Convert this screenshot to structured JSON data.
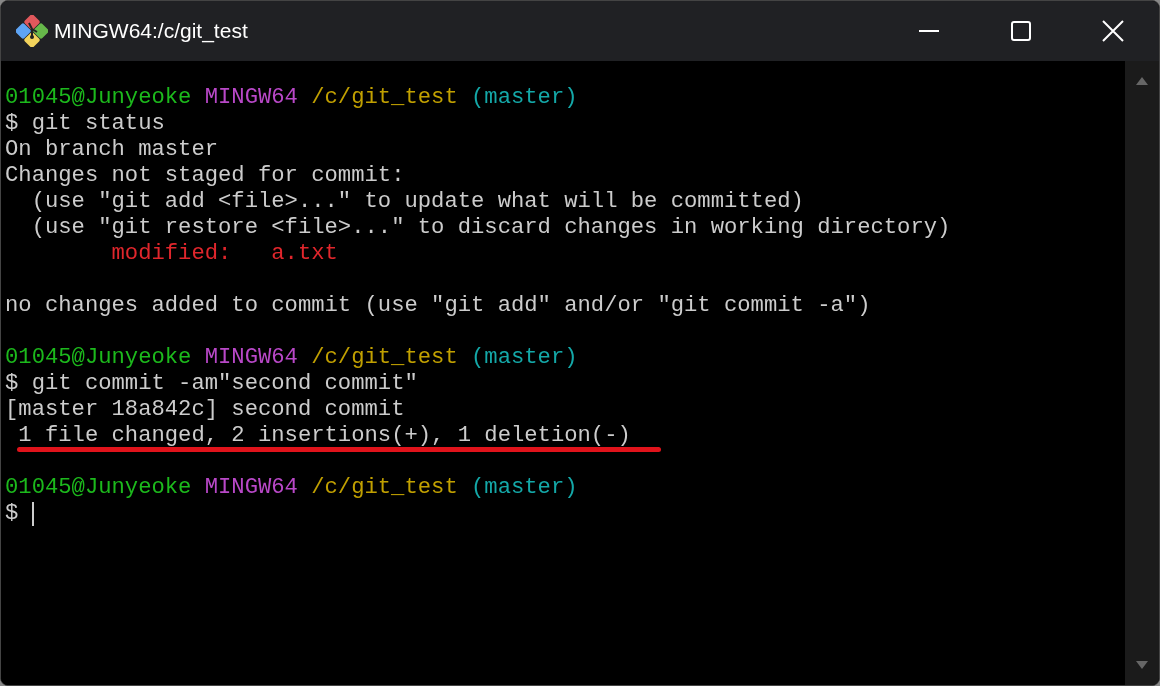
{
  "window": {
    "title": "MINGW64:/c/git_test"
  },
  "terminal": {
    "blocks": [
      {
        "lines": [
          {
            "segments": [
              {
                "kind": "user",
                "text": "01045@Junyeoke"
              },
              {
                "kind": "host",
                "text": "MINGW64"
              },
              {
                "kind": "path",
                "text": "/c/git_test"
              },
              {
                "kind": "branch",
                "text": "(master)"
              }
            ]
          },
          {
            "segments": [
              {
                "kind": "plain",
                "text": "$ git status"
              }
            ]
          },
          {
            "segments": [
              {
                "kind": "plain",
                "text": "On branch master"
              }
            ]
          },
          {
            "segments": [
              {
                "kind": "plain",
                "text": "Changes not staged for commit:"
              }
            ]
          },
          {
            "segments": [
              {
                "kind": "plain",
                "text": "  (use \"git add <file>...\" to update what will be committed)"
              }
            ]
          },
          {
            "segments": [
              {
                "kind": "plain",
                "text": "  (use \"git restore <file>...\" to discard changes in working directory)"
              }
            ]
          },
          {
            "segments": [
              {
                "kind": "modified",
                "text": "        modified:   a.txt"
              }
            ]
          }
        ]
      },
      {
        "lines": [
          {
            "segments": [
              {
                "kind": "plain",
                "text": "no changes added to commit (use \"git add\" and/or \"git commit -a\")"
              }
            ]
          }
        ]
      },
      {
        "lines": [
          {
            "segments": [
              {
                "kind": "user",
                "text": "01045@Junyeoke"
              },
              {
                "kind": "host",
                "text": "MINGW64"
              },
              {
                "kind": "path",
                "text": "/c/git_test"
              },
              {
                "kind": "branch",
                "text": "(master)"
              }
            ]
          },
          {
            "segments": [
              {
                "kind": "plain",
                "text": "$ git commit -am\"second commit\""
              }
            ]
          },
          {
            "segments": [
              {
                "kind": "plain",
                "text": "[master 18a842c] second commit"
              }
            ]
          },
          {
            "segments": [
              {
                "kind": "plain",
                "text": " 1 file changed, 2 insertions(+), 1 deletion(-)"
              }
            ],
            "underlined": true
          }
        ]
      },
      {
        "lines": [
          {
            "segments": [
              {
                "kind": "user",
                "text": "01045@Junyeoke"
              },
              {
                "kind": "host",
                "text": "MINGW64"
              },
              {
                "kind": "path",
                "text": "/c/git_test"
              },
              {
                "kind": "branch",
                "text": "(master)"
              }
            ]
          },
          {
            "segments": [
              {
                "kind": "plain",
                "text": "$"
              }
            ],
            "cursor": true
          }
        ]
      }
    ]
  }
}
